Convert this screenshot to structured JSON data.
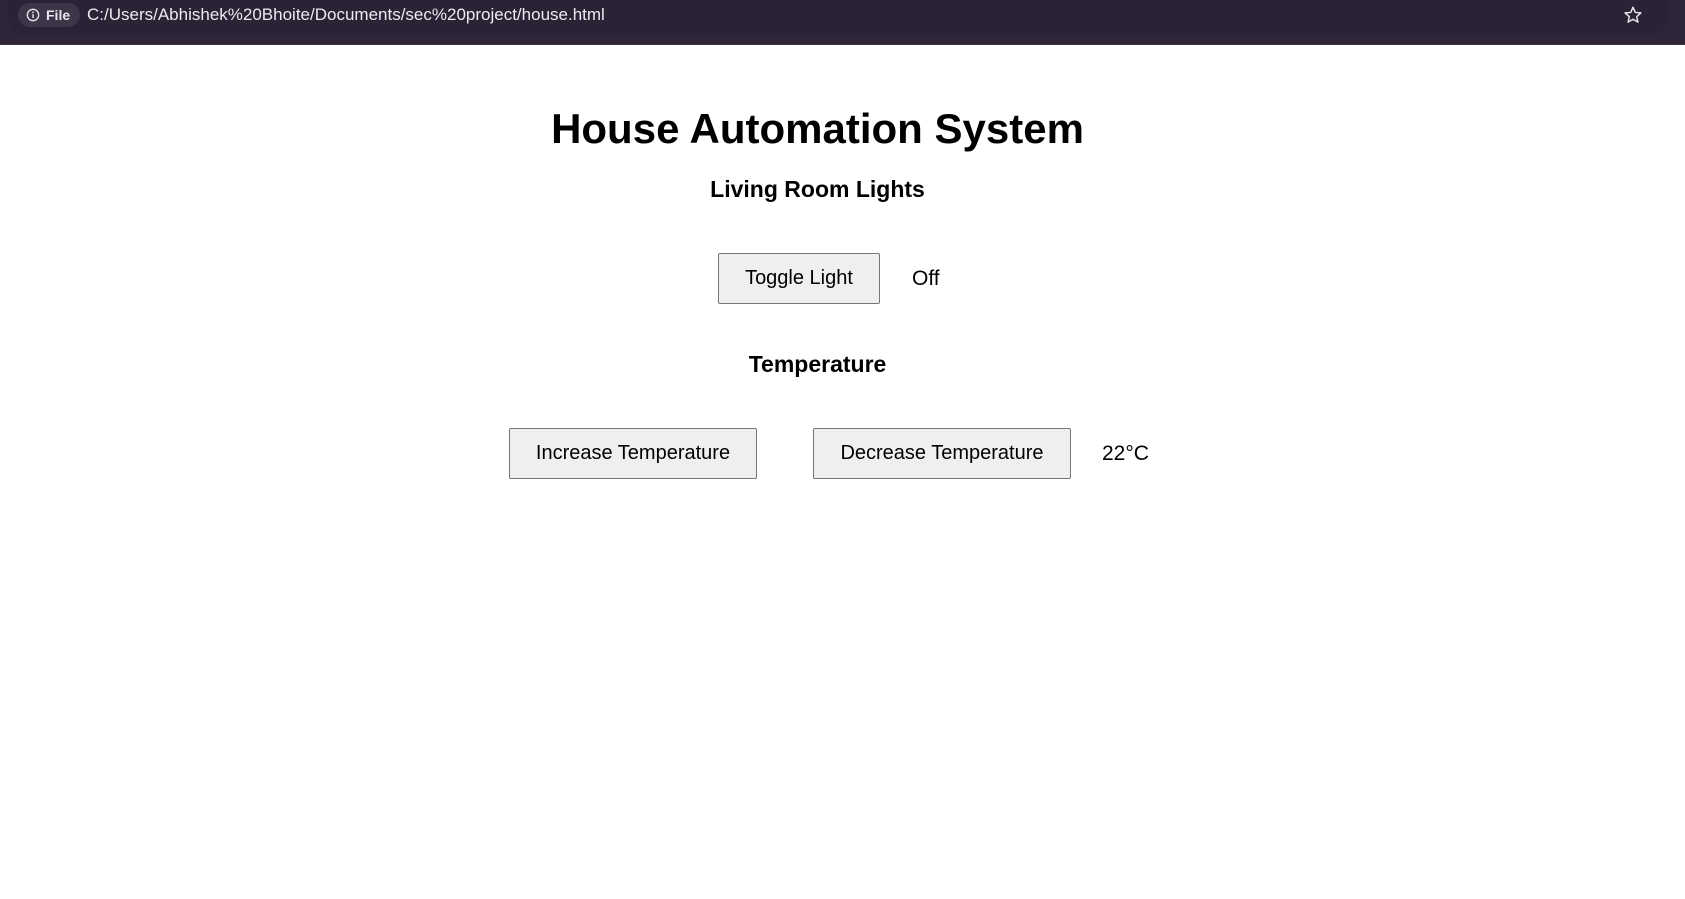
{
  "browser": {
    "chip_label": "File",
    "url": "C:/Users/Abhishek%20Bhoite/Documents/sec%20project/house.html",
    "icons": [
      "info-icon",
      "star-icon"
    ]
  },
  "page": {
    "title": "House Automation System",
    "lights": {
      "heading": "Living Room Lights",
      "toggle_label": "Toggle Light",
      "status": "Off"
    },
    "temperature": {
      "heading": "Temperature",
      "increase_label": "Increase Temperature",
      "decrease_label": "Decrease Temperature",
      "value": "22°C"
    }
  },
  "colors": {
    "browser_bar": "#2e2638",
    "button_bg": "#efefef",
    "button_border": "#767676"
  }
}
